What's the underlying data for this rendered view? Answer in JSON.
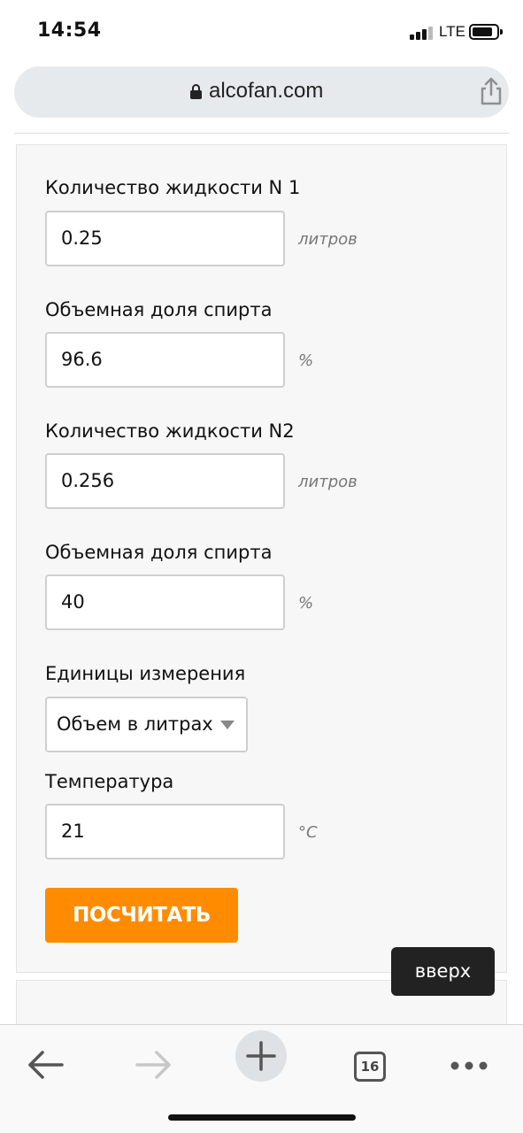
{
  "status_bar": {
    "time": "14:54",
    "network": "LTE"
  },
  "browser": {
    "url": "alcofan.com",
    "tab_count": "16"
  },
  "form": {
    "liquid1_label": "Количество жидкости N 1",
    "liquid1_value": "0.25",
    "liquid1_unit": "литров",
    "alcohol1_label": "Объемная доля спирта",
    "alcohol1_value": "96.6",
    "alcohol1_unit": "%",
    "liquid2_label": "Количество жидкости N2",
    "liquid2_value": "0.256",
    "liquid2_unit": "литров",
    "alcohol2_label": "Объемная доля спирта",
    "alcohol2_value": "40",
    "alcohol2_unit": "%",
    "units_label": "Единицы измерения",
    "units_selected": "Объем в литрах",
    "temperature_label": "Температура",
    "temperature_value": "21",
    "temperature_unit": "°C",
    "calculate_button": "ПОСЧИТАТЬ"
  },
  "page": {
    "up_button": "вверх"
  },
  "colors": {
    "accent": "#ff8c00",
    "up_button_bg": "#222222"
  }
}
